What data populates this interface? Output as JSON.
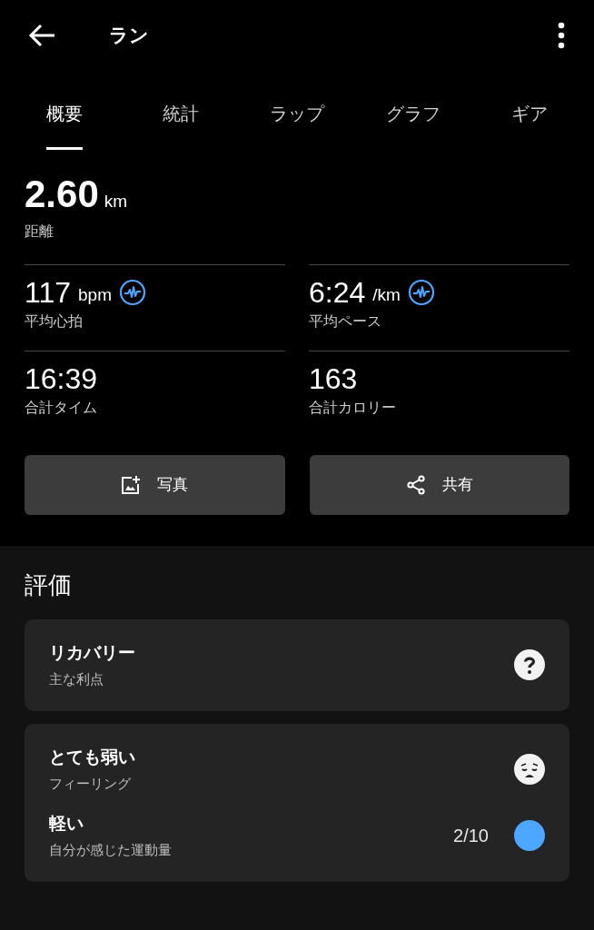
{
  "header": {
    "title": "ラン"
  },
  "tabs": [
    {
      "label": "概要",
      "selected": true
    },
    {
      "label": "統計",
      "selected": false
    },
    {
      "label": "ラップ",
      "selected": false
    },
    {
      "label": "グラフ",
      "selected": false
    },
    {
      "label": "ギア",
      "selected": false
    }
  ],
  "distance": {
    "value": "2.60",
    "unit": "km",
    "label": "距離"
  },
  "stats": [
    {
      "value": "117",
      "unit": "bpm",
      "label": "平均心拍",
      "graph_icon": true
    },
    {
      "value": "6:24",
      "unit": "/km",
      "label": "平均ペース",
      "graph_icon": true
    },
    {
      "value": "16:39",
      "label": "合計タイム",
      "graph_icon": false
    },
    {
      "value": "163",
      "label": "合計カロリー",
      "graph_icon": false
    }
  ],
  "buttons": [
    {
      "kind": "photo",
      "label": "写真"
    },
    {
      "kind": "share",
      "label": "共有"
    }
  ],
  "evaluation": {
    "title": "評価",
    "cards": [
      {
        "rows": [
          {
            "kind": "question",
            "title": "リカバリー",
            "subtitle": "主な利点"
          }
        ]
      },
      {
        "rows": [
          {
            "kind": "face",
            "title": "とても弱い",
            "subtitle": "フィーリング"
          },
          {
            "kind": "dot",
            "title": "軽い",
            "subtitle": "自分が感じた運動量",
            "value": "2/10",
            "color": "#4da6ff"
          }
        ]
      }
    ]
  }
}
